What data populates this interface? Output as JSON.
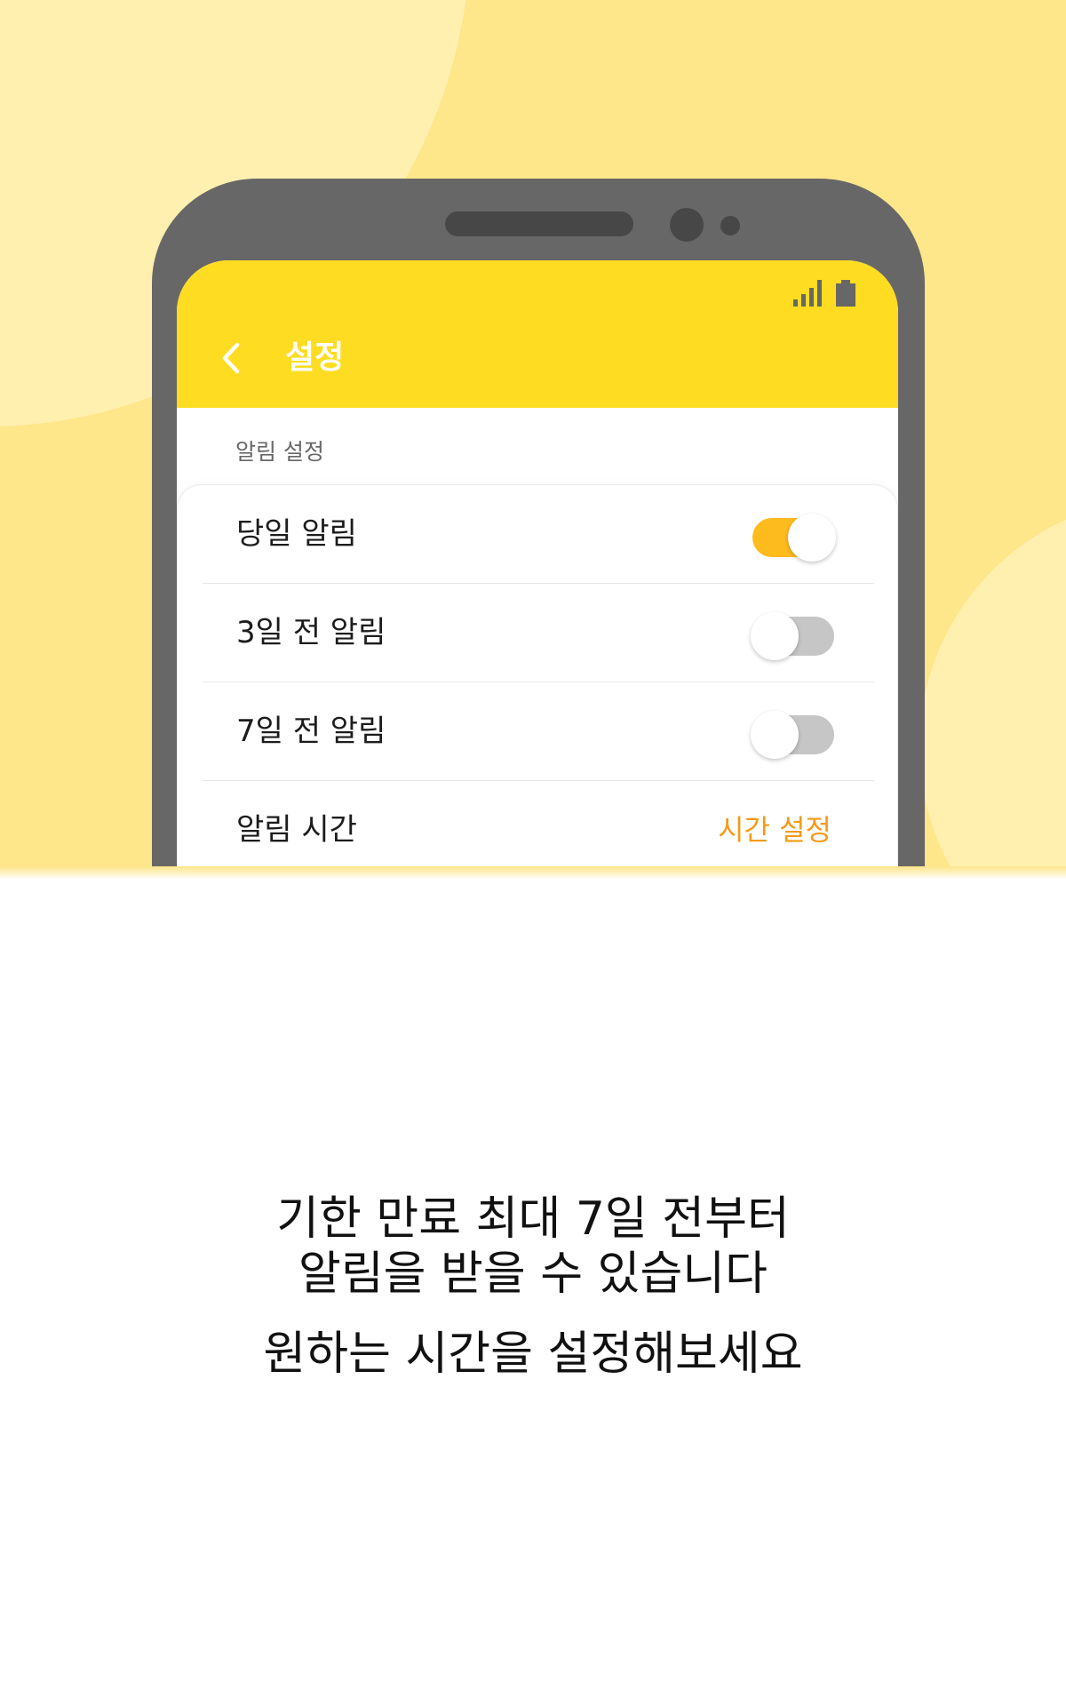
{
  "app": {
    "title": "설정",
    "back_icon": "chevron-left-icon",
    "status_icons": [
      "signal-icon",
      "battery-icon"
    ]
  },
  "settings": {
    "section_label": "알림 설정",
    "rows": [
      {
        "label": "당일 알림",
        "toggle": true
      },
      {
        "label": "3일 전 알림",
        "toggle": false
      },
      {
        "label": "7일 전 알림",
        "toggle": false
      },
      {
        "label": "알림 시간",
        "action": "시간 설정"
      }
    ]
  },
  "caption": {
    "line1": "기한 만료 최대 7일 전부터",
    "line2": "알림을 받을 수 있습니다",
    "line3": "원하는 시간을 설정해보세요"
  },
  "colors": {
    "hero_background": "#fee68a",
    "appbar": "#fedc22",
    "toggle_on": "#fdbb1e",
    "toggle_off": "#c6c6c6",
    "action_link": "#f59a16",
    "phone_frame": "#676767"
  }
}
